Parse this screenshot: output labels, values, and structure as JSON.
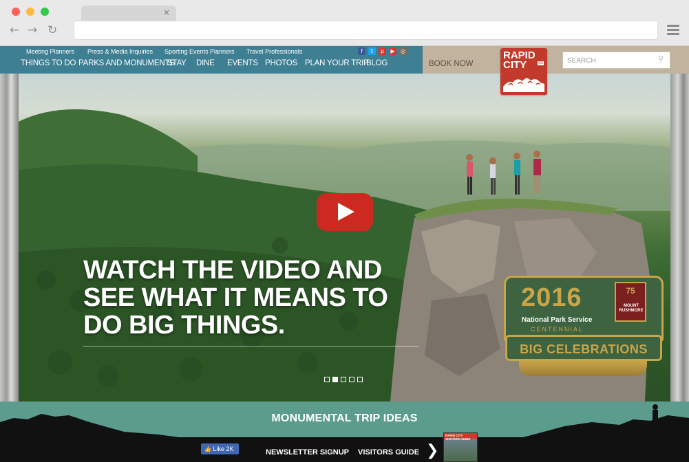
{
  "browser": {
    "tab_close": "×",
    "back_icon": "←",
    "forward_icon": "→",
    "reload_icon": "↻"
  },
  "utility_nav": [
    "Meeting Planners",
    "Press & Media Inquiries",
    "Sporting Events Planners",
    "Travel Professionals"
  ],
  "social": [
    "f",
    "t",
    "p",
    "▶",
    "◎"
  ],
  "main_nav": [
    "THINGS TO DO",
    "PARKS AND MONUMENTS",
    "STAY",
    "DINE",
    "EVENTS",
    "PHOTOS",
    "PLAN YOUR TRIP",
    "BLOG"
  ],
  "book_now": "BOOK NOW",
  "logo": {
    "line1": "RAPID",
    "line2": "CITY",
    "badge": "SD"
  },
  "search": {
    "placeholder": "SEARCH",
    "icon": "⚲"
  },
  "hero": {
    "headline": "WATCH THE VIDEO AND SEE WHAT IT MEANS TO DO BIG THINGS.",
    "slides": 5,
    "active_slide": 2
  },
  "badge": {
    "year": "2016",
    "org": "National Park Service",
    "centennial": "CENTENNIAL",
    "monument": "MOUNT RUSHMORE",
    "anniversary": "75",
    "banner": "BIG CELEBRATIONS"
  },
  "band": {
    "title": "MONUMENTAL TRIP IDEAS"
  },
  "footer": {
    "like_label": "Like 2K",
    "newsletter": "NEWSLETTER SIGNUP",
    "visitors_guide": "VISITORS GUIDE",
    "chevron": "❯",
    "guide_cover_title": "RAPID CITY VISITORS GUIDE"
  },
  "colors": {
    "header_teal": "#3f7f93",
    "book_now_tan": "#c1b39d",
    "logo_red": "#c23a2b",
    "play_red": "#cc2a20",
    "band_teal": "#5c9c8d",
    "badge_gold": "#c8a54a",
    "badge_green": "#3e6340"
  }
}
